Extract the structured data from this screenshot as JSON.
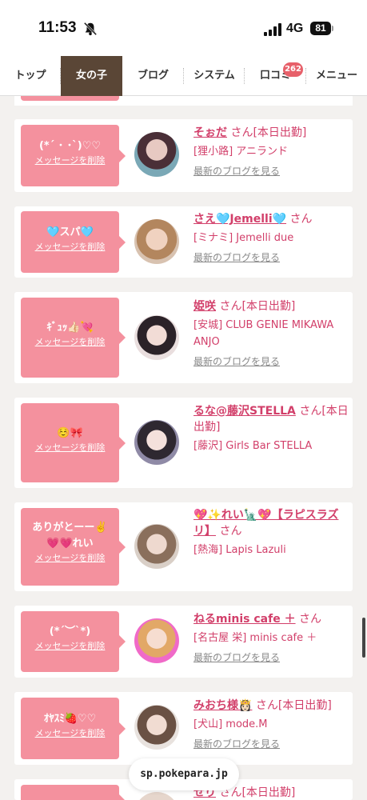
{
  "status_bar": {
    "time": "11:53",
    "network": "4G",
    "battery": "81"
  },
  "tabs": [
    {
      "label": "トップ"
    },
    {
      "label": "女の子"
    },
    {
      "label": "ブログ"
    },
    {
      "label": "システム"
    },
    {
      "label": "口コミ",
      "badge": "262"
    },
    {
      "label": "メニュー"
    }
  ],
  "colors": {
    "accent_pink": "#f4919e",
    "name_pink": "#d23f6a",
    "active_tab": "#5a4636"
  },
  "delete_label": "メッセージを削除",
  "blog_link": "最新のブログを見る",
  "cards": [
    {
      "message": "(*´ ･ ･`)♡♡",
      "name": "そぉだ",
      "suffix": " さん[本日出勤]",
      "shop": "[狸小路] アニランド"
    },
    {
      "message": "🩵スパ🩵",
      "name": "さえ🩵Jemelli🩵",
      "suffix": " さん",
      "shop": "[ミナミ] Jemelli due"
    },
    {
      "message": "ｷﾞｭｯ👍🏻💘",
      "name": "姫咲",
      "suffix": " さん[本日出勤]",
      "shop": "[安城] CLUB GENIE MIKAWA ANJO"
    },
    {
      "message": "☺️🎀",
      "name": "るな@藤沢STELLA",
      "suffix": " さん[本日出勤]",
      "shop": "[藤沢] Girls Bar STELLA"
    },
    {
      "message": "ありがとーー✌️💗💗れい",
      "name": "💖✨れい🗽💖【ラピスラズリ】",
      "suffix": " さん",
      "shop": "[熱海] Lapis Lazuli"
    },
    {
      "message": "(*´︶`*)",
      "name": "ねるminis cafe ＋",
      "suffix": " さん",
      "shop": "[名古屋 栄] minis cafe ＋"
    },
    {
      "message": "ｵﾔｽﾐ🍓♡♡",
      "name": "みおち様👸🏻",
      "suffix": " さん[本日出勤]",
      "shop": "[犬山] mode.M"
    },
    {
      "message": "",
      "name": "せり",
      "suffix": " さん[本日出勤]",
      "shop": ""
    }
  ],
  "url": "sp.pokepara.jp"
}
